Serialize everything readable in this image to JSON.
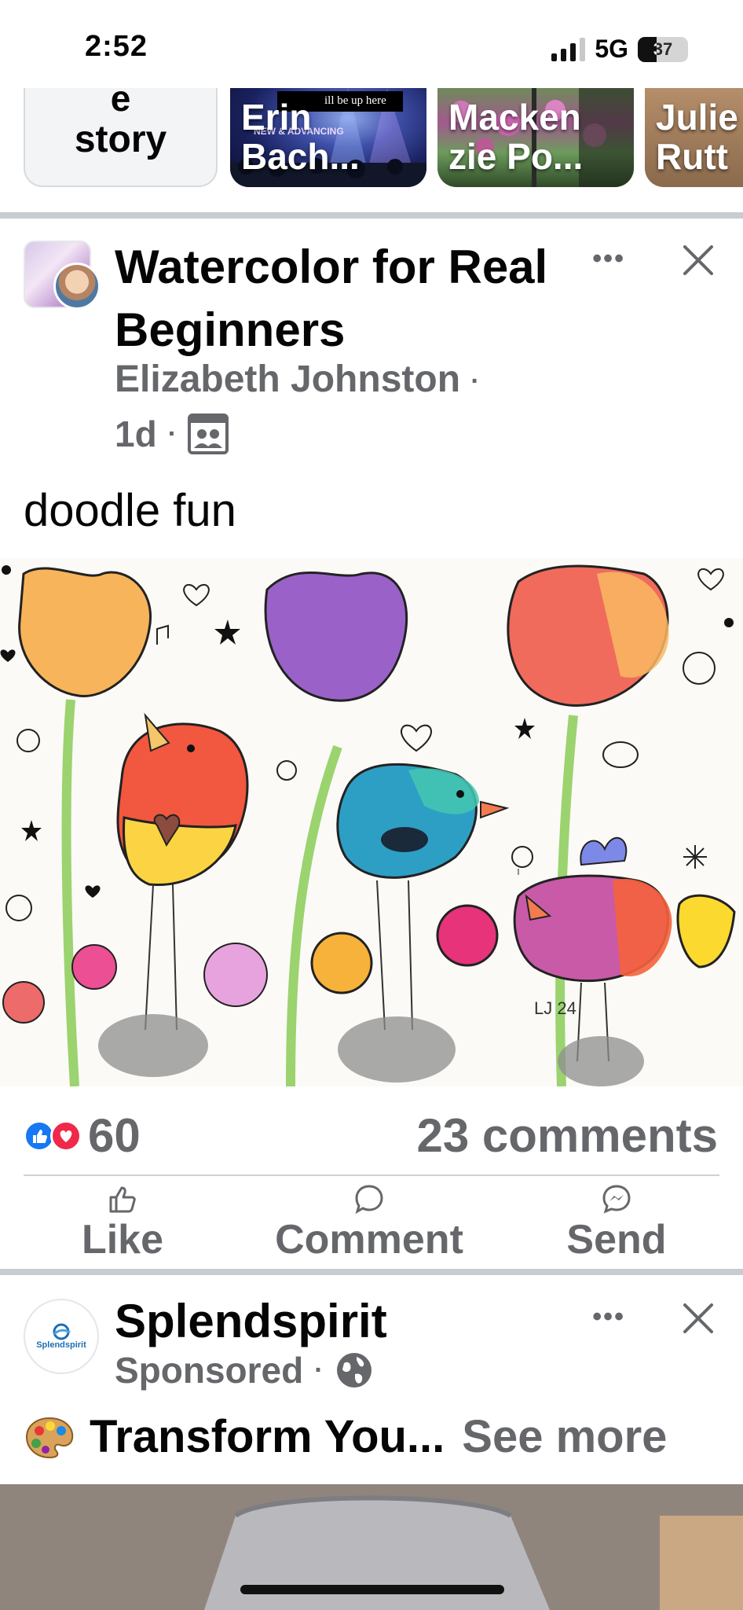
{
  "status_bar": {
    "time": "2:52",
    "network": "5G",
    "battery": "37",
    "battery_level": 0.37
  },
  "stories": {
    "create": {
      "line1": "e",
      "line2": "story"
    },
    "items": [
      {
        "name_top": "Erin",
        "name_bottom": "Bach...",
        "overlay_text": "ill be up here",
        "overlay_sub": "NEW & ADVANCING"
      },
      {
        "name_top": "Macken",
        "name_bottom": "zie Po..."
      },
      {
        "name_top": "Julie",
        "name_bottom": "Rutt"
      }
    ]
  },
  "post": {
    "group_title": "Watercolor for Real Beginners",
    "author": "Elizabeth Johnston",
    "time": "1d",
    "text": "doodle fun",
    "image_signature": "LJ 24",
    "reaction_count": "60",
    "comment_count": "23 comments",
    "actions": {
      "like": "Like",
      "comment": "Comment",
      "send": "Send"
    }
  },
  "sponsored": {
    "name": "Splendspirit",
    "logo_text": "Splendspirit",
    "label": "Sponsored",
    "text": "Transform You...",
    "see_more": "See more"
  },
  "colors": {
    "brand_blue": "#1877f2",
    "love_red": "#f02849",
    "secondary_text": "#65676b"
  }
}
